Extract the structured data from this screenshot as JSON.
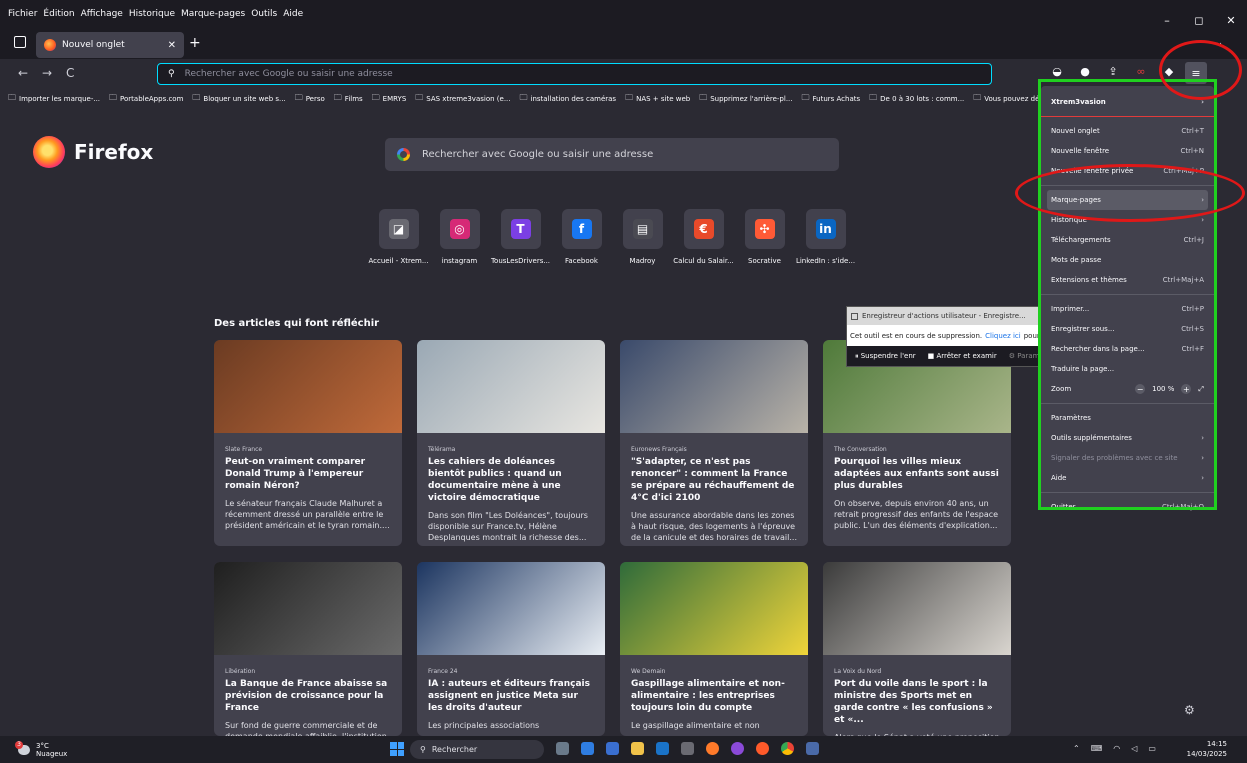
{
  "menubar": {
    "items": [
      "Fichier",
      "Édition",
      "Affichage",
      "Historique",
      "Marque-pages",
      "Outils",
      "Aide"
    ]
  },
  "window_controls": {
    "minimize": "–",
    "restore": "◻",
    "close": "✕"
  },
  "tab": {
    "title": "Nouvel onglet",
    "close": "✕",
    "new_tab": "+"
  },
  "navbar": {
    "back": "←",
    "forward": "→",
    "reload": "C",
    "url_placeholder": "Rechercher avec Google ou saisir une adresse"
  },
  "bookmarks": [
    "Importer les marque-...",
    "PortableApps.com",
    "Bloquer un site web s...",
    "Perso",
    "Films",
    "EMRYS",
    "SAS xtreme3vasion (e...",
    "installation des caméras",
    "NAS + site web",
    "Supprimez l'arrière-pl...",
    "Futurs Achats",
    "De 0 à 30 lots : comm...",
    "Vous pouvez déplace"
  ],
  "newtab": {
    "brand": "Firefox",
    "search_placeholder": "Rechercher avec Google ou saisir une adresse",
    "shortcuts": [
      {
        "label": "Accueil - Xtrem...",
        "glyph": "◪",
        "color": "#6a6a72"
      },
      {
        "label": "instagram",
        "glyph": "◎",
        "color": "#d62976"
      },
      {
        "label": "TousLesDrivers...",
        "glyph": "T",
        "color": "#7b3fe4"
      },
      {
        "label": "Facebook",
        "glyph": "f",
        "color": "#1877f2"
      },
      {
        "label": "Madroy",
        "glyph": "▤",
        "color": "#4a4a52"
      },
      {
        "label": "Calcul du Salair...",
        "glyph": "€",
        "color": "#e84a2a"
      },
      {
        "label": "Socrative",
        "glyph": "✣",
        "color": "#ff5a36"
      },
      {
        "label": "LinkedIn : s'ide...",
        "glyph": "in",
        "color": "#0a66c2"
      }
    ],
    "articles_title": "Des articles qui font réfléchir",
    "articles": [
      {
        "source": "Slate France",
        "title": "Peut-on vraiment comparer Donald Trump à l'empereur romain Néron?",
        "desc": "Le sénateur français Claude Malhuret a récemment dressé un parallèle entre le président américain et le tyran romain....",
        "color1": "#6b3b22",
        "color2": "#c06a3a"
      },
      {
        "source": "Télérama",
        "title": "Les cahiers de doléances bientôt publics : quand un documentaire mène à une victoire démocratique",
        "desc": "Dans son film \"Les Doléances\", toujours disponible sur France.tv, Hélène Desplanques montrait la richesse des...",
        "color1": "#9aa8b4",
        "color2": "#e8e6e1"
      },
      {
        "source": "Euronews Français",
        "title": "\"S'adapter, ce n'est pas renoncer\" : comment la France se prépare au réchauffement de 4°C d'ici 2100",
        "desc": "Une assurance abordable dans les zones à haut risque, des logements à l'épreuve de la canicule et des horaires de travail...",
        "color1": "#3a4a6b",
        "color2": "#b9b3a8"
      },
      {
        "source": "The Conversation",
        "title": "Pourquoi les villes mieux adaptées aux enfants sont aussi plus durables",
        "desc": "On observe, depuis environ 40 ans, un retrait progressif des enfants de l'espace public. L'un des éléments d'explication...",
        "color1": "#4f7a3a",
        "color2": "#a9b58a"
      },
      {
        "source": "Libération",
        "title": "La Banque de France abaisse sa prévision de croissance pour la France",
        "desc": "Sur fond de guerre commerciale et de demande mondiale affaiblie, l'institution",
        "color1": "#1f1f1f",
        "color2": "#6a6a6a"
      },
      {
        "source": "France 24",
        "title": "IA : auteurs et éditeurs français assignent en justice Meta sur les droits d'auteur",
        "desc": "Les principales associations",
        "color1": "#1c3560",
        "color2": "#e9eef4"
      },
      {
        "source": "We Demain",
        "title": "Gaspillage alimentaire et non-alimentaire : les entreprises toujours loin du compte",
        "desc": "Le gaspillage alimentaire et non",
        "color1": "#2f6b3a",
        "color2": "#f0d53a"
      },
      {
        "source": "La Voix du Nord",
        "title": "Port du voile dans le sport : la ministre des Sports met en garde contre « les confusions » et «...",
        "desc": "Alors que le Sénat a voté une proposition",
        "color1": "#3b3b3b",
        "color2": "#d9d5cf"
      }
    ]
  },
  "appmenu": {
    "account": "Xtrem3vasion",
    "items": [
      {
        "label": "Nouvel onglet",
        "shortcut": "Ctrl+T"
      },
      {
        "label": "Nouvelle fenêtre",
        "shortcut": "Ctrl+N"
      },
      {
        "label": "Nouvelle fenêtre privée",
        "shortcut": "Ctrl+Maj+P"
      }
    ],
    "items2": [
      {
        "label": "Marque-pages",
        "arrow": "›"
      },
      {
        "label": "Historique",
        "arrow": "›"
      },
      {
        "label": "Téléchargements",
        "shortcut": "Ctrl+J"
      },
      {
        "label": "Mots de passe",
        "shortcut": ""
      },
      {
        "label": "Extensions et thèmes",
        "shortcut": "Ctrl+Maj+A"
      }
    ],
    "items3": [
      {
        "label": "Imprimer...",
        "shortcut": "Ctrl+P"
      },
      {
        "label": "Enregistrer sous...",
        "shortcut": "Ctrl+S"
      },
      {
        "label": "Rechercher dans la page...",
        "shortcut": "Ctrl+F"
      },
      {
        "label": "Traduire la page...",
        "shortcut": ""
      }
    ],
    "zoom_label": "Zoom",
    "zoom_value": "100 %",
    "items4": [
      {
        "label": "Paramètres",
        "arrow": ""
      },
      {
        "label": "Outils supplémentaires",
        "arrow": "›"
      },
      {
        "label": "Signaler des problèmes avec ce site",
        "arrow": "›"
      },
      {
        "label": "Aide",
        "arrow": "›"
      }
    ],
    "quit": {
      "label": "Quitter",
      "shortcut": "Ctrl+Maj+Q"
    }
  },
  "recorder": {
    "title": "Enregistreur d'actions utilisateur - Enregistre...",
    "message_before": "Cet outil est en cours de suppression.",
    "link": "Cliquez ici",
    "message_after": "pour explorer d'autres solutions.",
    "pause": "Suspendre l'enr",
    "stop": "Arrêter et examir",
    "settings": "Paramètres"
  },
  "taskbar": {
    "weather_temp": "3°C",
    "weather_desc": "Nuageux",
    "search": "Rechercher",
    "time": "14:15",
    "date": "14/03/2025"
  },
  "annotation_colors": {
    "green": "#20d020",
    "red": "#e01818"
  }
}
